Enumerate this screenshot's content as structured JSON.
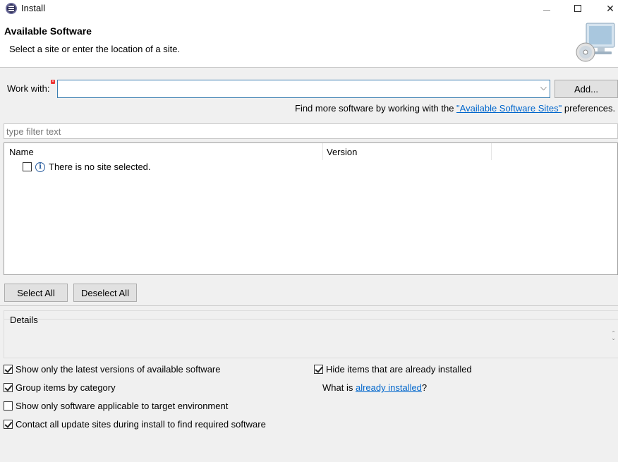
{
  "window": {
    "title": "Install",
    "icon": "eclipse-icon"
  },
  "header": {
    "title": "Available Software",
    "subtitle": "Select a site or enter the location of a site.",
    "banner_icon": "software-install-monitor-icon"
  },
  "work_with": {
    "label": "Work with:",
    "value": "",
    "add_label": "Add..."
  },
  "find_more": {
    "prefix": "Find more software by working with the ",
    "link": "\"Available Software Sites\"",
    "suffix": " preferences."
  },
  "filter": {
    "placeholder": "type filter text"
  },
  "table": {
    "columns": [
      "Name",
      "Version"
    ],
    "rows": [
      {
        "label": "There is no site selected.",
        "checked": false,
        "icon": "info-icon"
      }
    ]
  },
  "buttons": {
    "select_all": "Select All",
    "deselect_all": "Deselect All"
  },
  "details": {
    "label": "Details"
  },
  "options": {
    "latest_versions": {
      "label": "Show only the latest versions of available software",
      "checked": true
    },
    "group_by_category": {
      "label": "Group items by category",
      "checked": true
    },
    "target_environment": {
      "label": "Show only software applicable to target environment",
      "checked": false
    },
    "contact_sites": {
      "label": "Contact all update sites during install to find required software",
      "checked": true
    },
    "hide_installed": {
      "label": "Hide items that are already installed",
      "checked": true
    }
  },
  "what_is": {
    "prefix": "What is ",
    "link": "already installed",
    "suffix": "?"
  }
}
